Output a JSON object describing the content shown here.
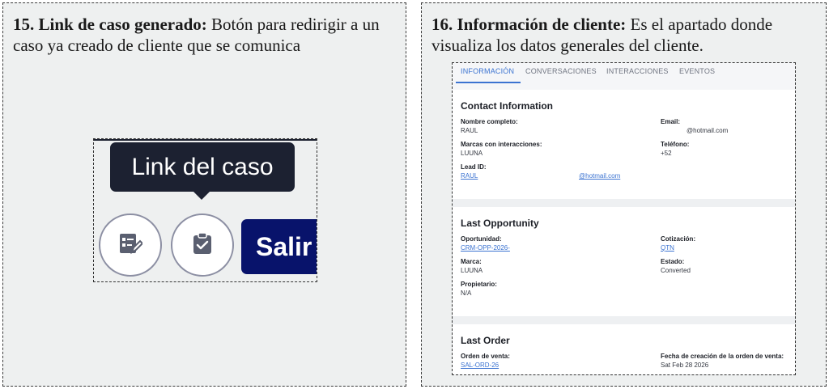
{
  "left_panel": {
    "caption_bold": "15. Link de caso generado:",
    "caption_text": " Botón para redirigir a un caso ya creado de cliente que se comunica",
    "tooltip": "Link del caso",
    "exit_button": "Salir"
  },
  "right_panel": {
    "caption_bold": "16. Información de cliente:",
    "caption_text": " Es el apartado donde visualiza los datos generales del cliente.",
    "tabs": [
      "INFORMACIÓN",
      "CONVERSACIONES",
      "INTERACCIONES",
      "EVENTOS"
    ],
    "contact": {
      "title": "Contact Information",
      "name_label": "Nombre completo:",
      "name_value": "RAUL",
      "email_label": "Email:",
      "email_value": "@hotmail.com",
      "brands_label": "Marcas con interacciones:",
      "brands_value": "LUUNA",
      "phone_label": "Teléfono:",
      "phone_value": "+52",
      "lead_label": "Lead ID:",
      "lead_value_a": "RAUL",
      "lead_value_b": "@hotmail.com"
    },
    "opportunity": {
      "title": "Last Opportunity",
      "opp_label": "Oportunidad:",
      "opp_value": "CRM-OPP-2026-",
      "quote_label": "Cotización:",
      "quote_value": "QTN",
      "brand_label": "Marca:",
      "brand_value": "LUUNA",
      "status_label": "Estado:",
      "status_value": "Converted",
      "owner_label": "Propietario:",
      "owner_value": "N/A"
    },
    "order": {
      "title": "Last Order",
      "order_label": "Orden de venta:",
      "order_value": "SAL-ORD-26",
      "date_label": "Fecha de creación de la orden de venta:",
      "date_value": "Sat Feb 28 2026"
    }
  },
  "colors": {
    "tooltip_bg": "#1c2131",
    "exit_button_bg": "#08136b",
    "link_blue": "#3b73d1"
  },
  "icons": [
    "edit-form-icon",
    "clipboard-check-icon"
  ]
}
